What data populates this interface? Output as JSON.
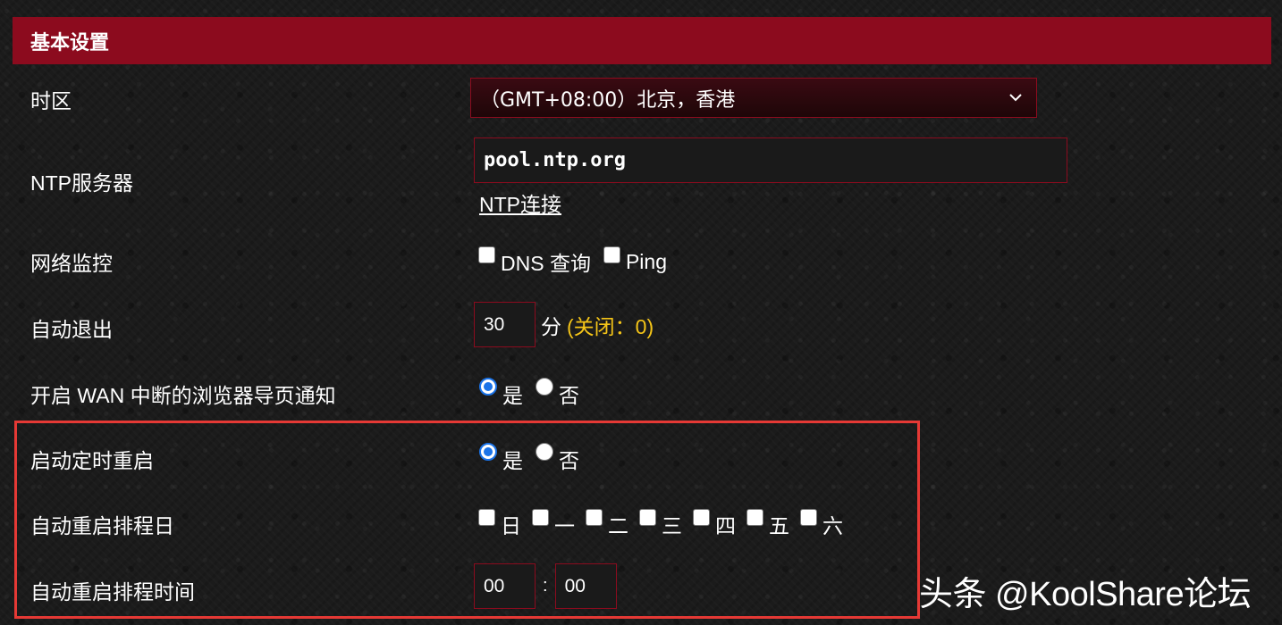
{
  "section": {
    "title": "基本设置"
  },
  "timezone": {
    "label": "时区",
    "value": "（GMT+08:00）北京，香港"
  },
  "ntp": {
    "label": "NTP服务器",
    "value": "pool.ntp.org",
    "link": "NTP连接"
  },
  "network_monitor": {
    "label": "网络监控",
    "options": [
      "DNS 查询",
      "Ping"
    ]
  },
  "auto_logout": {
    "label": "自动退出",
    "value": "30",
    "unit": "分",
    "hint": "(关闭：0)"
  },
  "wan_notify": {
    "label": "开启 WAN 中断的浏览器导页通知",
    "yes": "是",
    "no": "否",
    "selected": "是"
  },
  "scheduled_reboot": {
    "label": "启动定时重启",
    "yes": "是",
    "no": "否",
    "selected": "是"
  },
  "reboot_days": {
    "label": "自动重启排程日",
    "days": [
      "日",
      "一",
      "二",
      "三",
      "四",
      "五",
      "六"
    ]
  },
  "reboot_time": {
    "label": "自动重启排程时间",
    "hour": "00",
    "separator": ":",
    "minute": "00"
  },
  "watermark": "头条 @KoolShare论坛",
  "colors": {
    "header": "#8c0b1e",
    "highlight_border": "#e53935",
    "hint": "#f5c518",
    "radio_selected": "#1a73e8"
  }
}
